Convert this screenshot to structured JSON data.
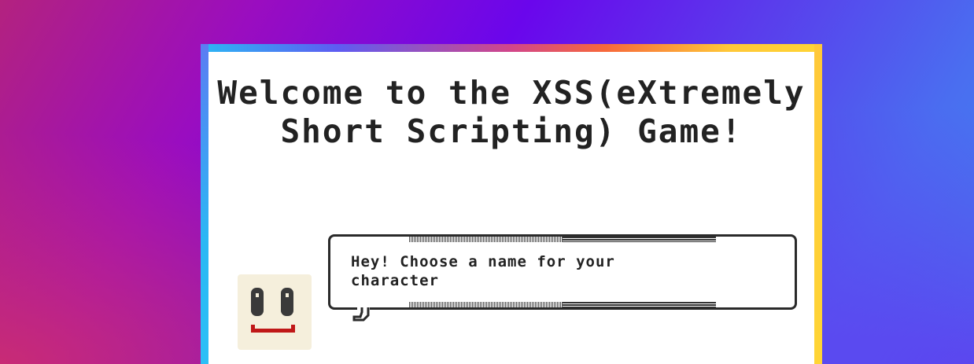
{
  "game": {
    "title": "Welcome to the XSS(eXtremely Short Scripting) Game!",
    "character": {
      "avatar_icon": "smiley-face-icon",
      "speech": "Hey! Choose a name for your character"
    }
  },
  "colors": {
    "frame_gradient": [
      "#2bb8f4",
      "#d2468a",
      "#f7683b",
      "#ffd535"
    ],
    "avatar_bg": "#f5efdc",
    "mouth": "#c01818",
    "text": "#222222"
  }
}
